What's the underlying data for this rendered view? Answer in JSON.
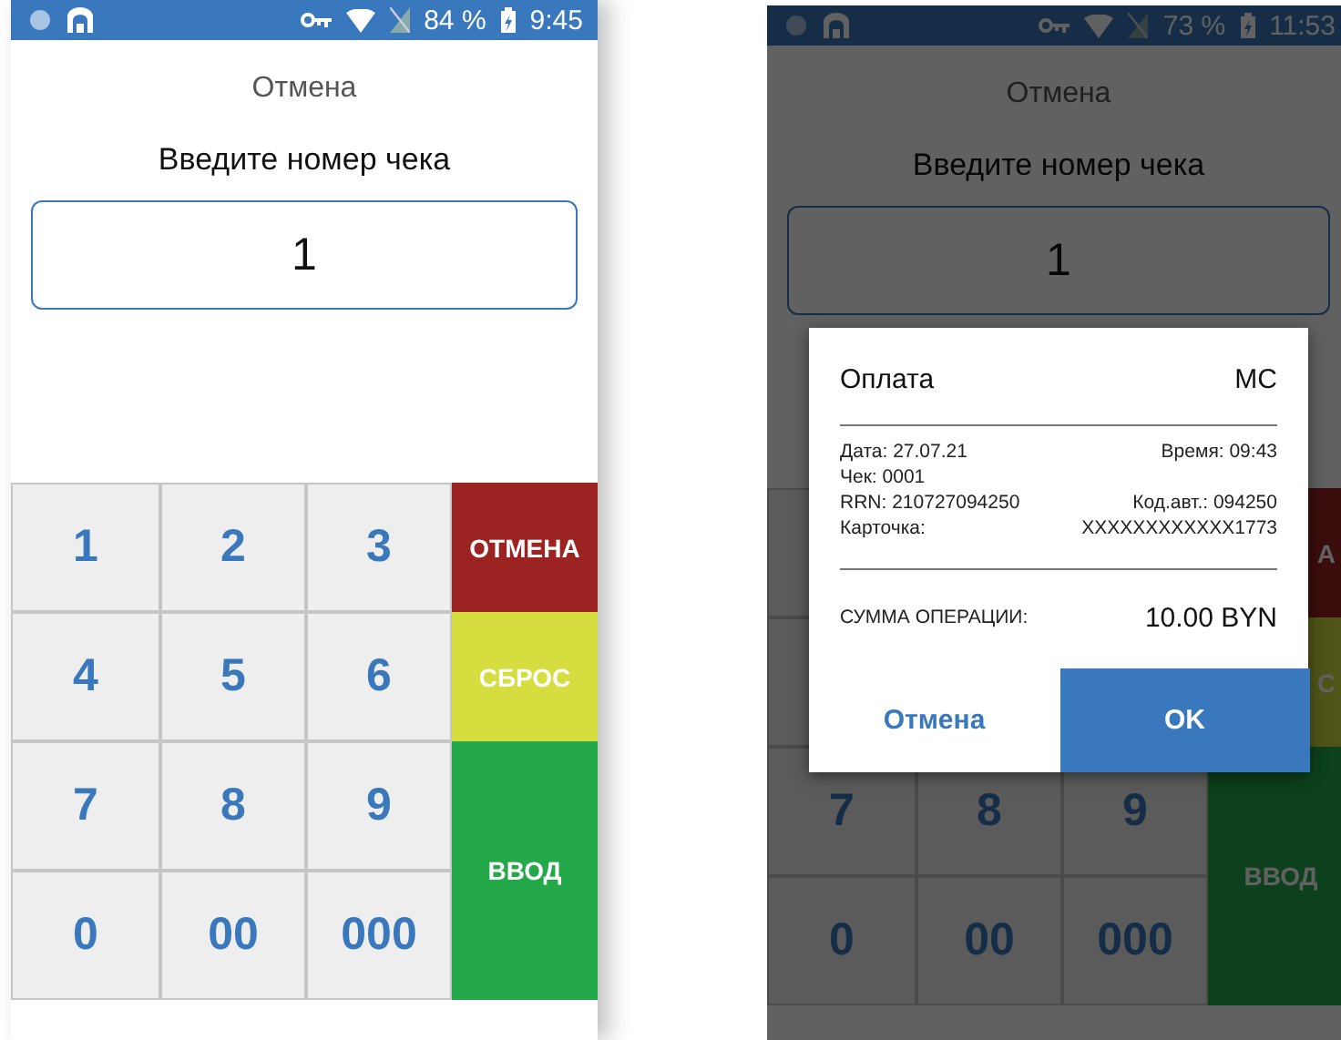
{
  "phones": [
    {
      "status_bar": {
        "battery": "84 %",
        "time": "9:45"
      },
      "cancel_label": "Отмена",
      "prompt": "Введите номер чека",
      "receipt_field": {
        "value": "1"
      },
      "keypad": [
        {
          "kind": "digit",
          "label": "1"
        },
        {
          "kind": "digit",
          "label": "2"
        },
        {
          "kind": "digit",
          "label": "3"
        },
        {
          "kind": "cancel",
          "label": "ОТМЕНА"
        },
        {
          "kind": "digit",
          "label": "4"
        },
        {
          "kind": "digit",
          "label": "5"
        },
        {
          "kind": "digit",
          "label": "6"
        },
        {
          "kind": "reset",
          "label": "СБРОС"
        },
        {
          "kind": "digit",
          "label": "7"
        },
        {
          "kind": "digit",
          "label": "8"
        },
        {
          "kind": "digit",
          "label": "9"
        },
        {
          "kind": "enter",
          "label": "ВВОД"
        },
        {
          "kind": "digit",
          "label": "0"
        },
        {
          "kind": "digit",
          "label": "00"
        },
        {
          "kind": "digit",
          "label": "000"
        }
      ]
    },
    {
      "status_bar": {
        "battery": "73 %",
        "time": "11:53"
      },
      "cancel_label": "Отмена",
      "prompt": "Введите номер чека",
      "receipt_field": {
        "value": "1"
      },
      "keypad": [
        {
          "kind": "digit"
        },
        {
          "kind": "digit"
        },
        {
          "kind": "digit"
        },
        {
          "kind": "cancel",
          "label": "А"
        },
        {
          "kind": "digit"
        },
        {
          "kind": "digit"
        },
        {
          "kind": "digit"
        },
        {
          "kind": "reset",
          "label": "С"
        },
        {
          "kind": "digit",
          "label": "7"
        },
        {
          "kind": "digit",
          "label": "8"
        },
        {
          "kind": "digit",
          "label": "9"
        },
        {
          "kind": "enter",
          "label": "ВВОД"
        },
        {
          "kind": "digit",
          "label": "0"
        },
        {
          "kind": "digit",
          "label": "00"
        },
        {
          "kind": "digit",
          "label": "000"
        }
      ],
      "dialog": {
        "title": "Оплата",
        "card_type": "MC",
        "details": [
          {
            "left": "Дата: 27.07.21",
            "right": "Время: 09:43"
          },
          {
            "left": "Чек: 0001"
          },
          {
            "left": "RRN: 210727094250",
            "right": "Код.авт.: 094250"
          },
          {
            "left": "Карточка:",
            "right": "XXXXXXXXXXXX1773"
          }
        ],
        "total_label": "СУММА ОПЕРАЦИИ:",
        "total_amount": "10.00 BYN",
        "buttons": [
          {
            "kind": "text",
            "label": "Отмена"
          },
          {
            "kind": "filled",
            "label": "OK"
          }
        ]
      }
    }
  ]
}
